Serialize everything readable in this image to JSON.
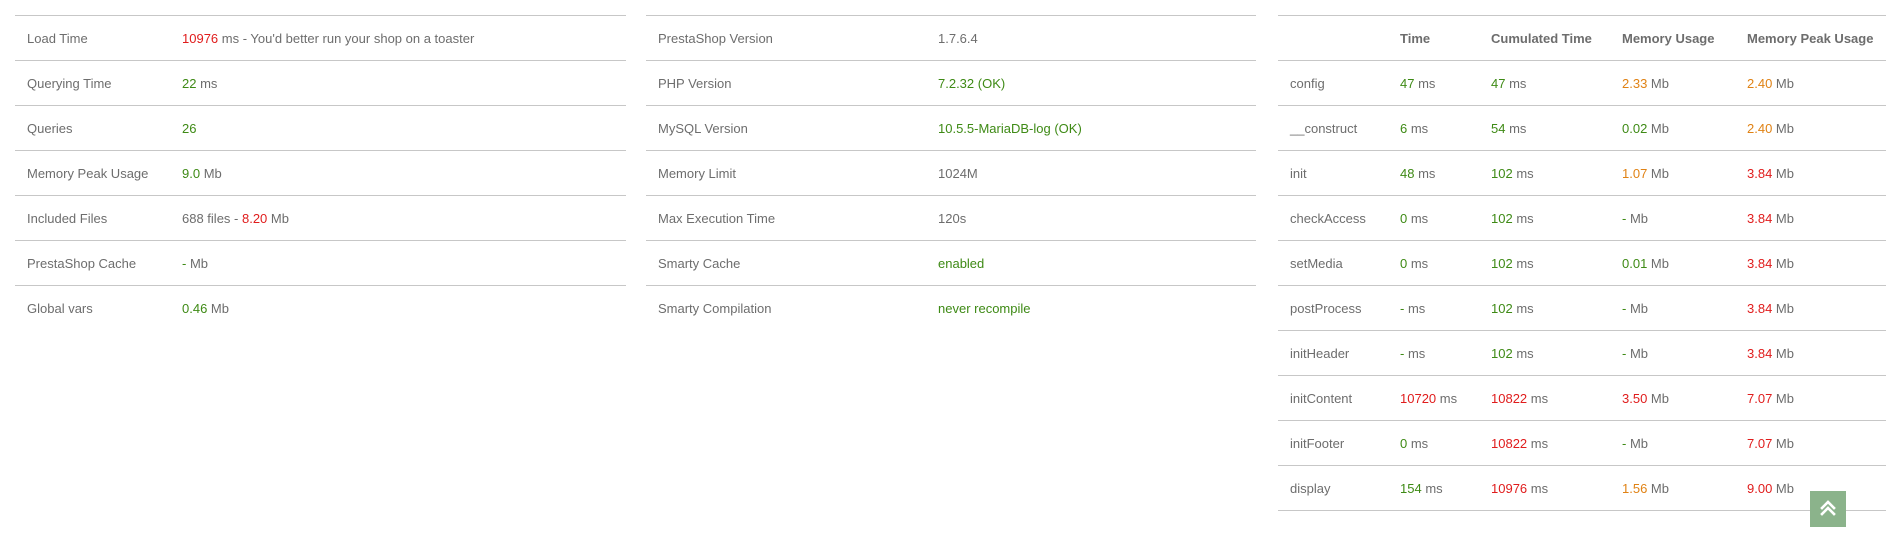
{
  "summary": {
    "rows": [
      {
        "label": "Load Time",
        "value": "10976",
        "value_color": "red",
        "suffix": " ms - You'd better run your shop on a toaster"
      },
      {
        "label": "Querying Time",
        "value": "22",
        "value_color": "green",
        "suffix": " ms"
      },
      {
        "label": "Queries",
        "value": "26",
        "value_color": "green",
        "suffix": ""
      },
      {
        "label": "Memory Peak Usage",
        "value": "9.0",
        "value_color": "green",
        "suffix": " Mb"
      },
      {
        "label": "Included Files",
        "value": "688 files - ",
        "value_color": "gray",
        "extra": "8.20",
        "extra_color": "red",
        "suffix": " Mb"
      },
      {
        "label": "PrestaShop Cache",
        "value": "-",
        "value_color": "green",
        "suffix": " Mb"
      },
      {
        "label": "Global vars",
        "value": "0.46",
        "value_color": "green",
        "suffix": " Mb"
      }
    ]
  },
  "environment": {
    "rows": [
      {
        "label": "PrestaShop Version",
        "value": "1.7.6.4",
        "value_color": "gray"
      },
      {
        "label": "PHP Version",
        "value": "7.2.32 (OK)",
        "value_color": "green"
      },
      {
        "label": "MySQL Version",
        "value": "10.5.5-MariaDB-log (OK)",
        "value_color": "green"
      },
      {
        "label": "Memory Limit",
        "value": "1024M",
        "value_color": "gray"
      },
      {
        "label": "Max Execution Time",
        "value": "120s",
        "value_color": "gray"
      },
      {
        "label": "Smarty Cache",
        "value": "enabled",
        "value_color": "green"
      },
      {
        "label": "Smarty Compilation",
        "value": "never recompile",
        "value_color": "green"
      }
    ]
  },
  "steps": {
    "headers": [
      "",
      "Time",
      "Cumulated Time",
      "Memory Usage",
      "Memory Peak Usage"
    ],
    "time_unit": " ms",
    "mem_unit": " Mb",
    "rows": [
      {
        "name": "config",
        "time": "47",
        "time_c": "green",
        "cum": "47",
        "cum_c": "green",
        "mem": "2.33",
        "mem_c": "orange",
        "peak": "2.40",
        "peak_c": "orange"
      },
      {
        "name": "__construct",
        "time": "6",
        "time_c": "green",
        "cum": "54",
        "cum_c": "green",
        "mem": "0.02",
        "mem_c": "green",
        "peak": "2.40",
        "peak_c": "orange"
      },
      {
        "name": "init",
        "time": "48",
        "time_c": "green",
        "cum": "102",
        "cum_c": "green",
        "mem": "1.07",
        "mem_c": "orange",
        "peak": "3.84",
        "peak_c": "red"
      },
      {
        "name": "checkAccess",
        "time": "0",
        "time_c": "green",
        "cum": "102",
        "cum_c": "green",
        "mem": "-",
        "mem_c": "green",
        "peak": "3.84",
        "peak_c": "red"
      },
      {
        "name": "setMedia",
        "time": "0",
        "time_c": "green",
        "cum": "102",
        "cum_c": "green",
        "mem": "0.01",
        "mem_c": "green",
        "peak": "3.84",
        "peak_c": "red"
      },
      {
        "name": "postProcess",
        "time": "-",
        "time_c": "green",
        "cum": "102",
        "cum_c": "green",
        "mem": "-",
        "mem_c": "green",
        "peak": "3.84",
        "peak_c": "red"
      },
      {
        "name": "initHeader",
        "time": "-",
        "time_c": "green",
        "cum": "102",
        "cum_c": "green",
        "mem": "-",
        "mem_c": "green",
        "peak": "3.84",
        "peak_c": "red"
      },
      {
        "name": "initContent",
        "time": "10720",
        "time_c": "red",
        "cum": "10822",
        "cum_c": "red",
        "mem": "3.50",
        "mem_c": "red",
        "peak": "7.07",
        "peak_c": "red"
      },
      {
        "name": "initFooter",
        "time": "0",
        "time_c": "green",
        "cum": "10822",
        "cum_c": "red",
        "mem": "-",
        "mem_c": "green",
        "peak": "7.07",
        "peak_c": "red"
      },
      {
        "name": "display",
        "time": "154",
        "time_c": "green",
        "cum": "10976",
        "cum_c": "red",
        "mem": "1.56",
        "mem_c": "orange",
        "peak": "9.00",
        "peak_c": "red"
      }
    ]
  },
  "scroll_top": {
    "icon": "double-chevron-up-icon"
  }
}
